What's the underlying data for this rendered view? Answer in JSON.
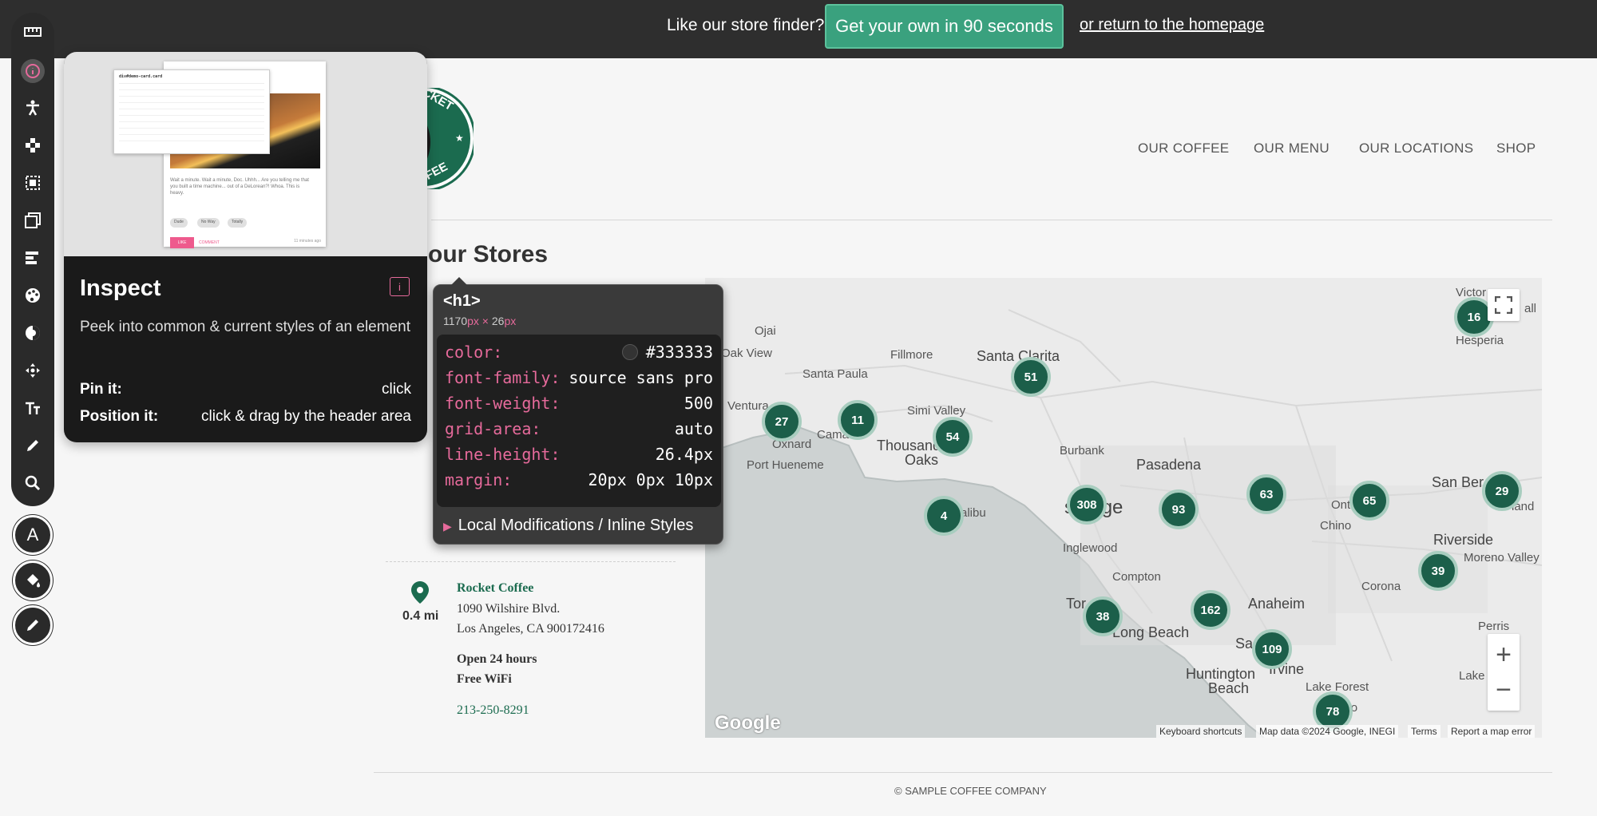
{
  "banner": {
    "prompt": "Like our store finder?",
    "cta": "Get your own in 90 seconds",
    "home_link": "or return to the homepage"
  },
  "logo": {
    "top_text": "CKET",
    "bottom_text": "FEE"
  },
  "nav": [
    "OUR COFFEE",
    "OUR MENU",
    "OUR LOCATIONS",
    "SHOP"
  ],
  "page_title": "our Stores",
  "map": {
    "places": [
      {
        "name": "Santa Clarita",
        "size": "big"
      },
      {
        "name": "Fillmore",
        "size": "normal"
      },
      {
        "name": "Santa Paula",
        "size": "normal"
      },
      {
        "name": "Ojai",
        "size": "normal"
      },
      {
        "name": "Oak View",
        "size": "normal"
      },
      {
        "name": "Ventura",
        "size": "normal"
      },
      {
        "name": "Oxnard",
        "size": "normal"
      },
      {
        "name": "Camar",
        "size": "normal"
      },
      {
        "name": "Simi Valley",
        "size": "normal"
      },
      {
        "name": "Thousand",
        "size": "big"
      },
      {
        "name": "Oaks",
        "size": "big"
      },
      {
        "name": "Port Hueneme",
        "size": "normal"
      },
      {
        "name": "Burbank",
        "size": "normal"
      },
      {
        "name": "Pasadena",
        "size": "big"
      },
      {
        "name": "s Ange",
        "size": "big"
      },
      {
        "name": "alibu",
        "size": "normal"
      },
      {
        "name": "Inglewood",
        "size": "normal"
      },
      {
        "name": "Compton",
        "size": "normal"
      },
      {
        "name": "Tor",
        "size": "big"
      },
      {
        "name": "Long Beach",
        "size": "big"
      },
      {
        "name": "Anaheim",
        "size": "big"
      },
      {
        "name": "Sa",
        "size": "big"
      },
      {
        "name": "Irvine",
        "size": "big"
      },
      {
        "name": "Huntington",
        "size": "big"
      },
      {
        "name": "Beach",
        "size": "big"
      },
      {
        "name": "Lake Forest",
        "size": "normal"
      },
      {
        "name": "Viejo",
        "size": "normal"
      },
      {
        "name": "Ont",
        "size": "normal"
      },
      {
        "name": "Chino",
        "size": "normal"
      },
      {
        "name": "Corona",
        "size": "normal"
      },
      {
        "name": "Riverside",
        "size": "big"
      },
      {
        "name": "Moreno Valley",
        "size": "normal"
      },
      {
        "name": "San Ber",
        "size": "big"
      },
      {
        "name": "Hesperia",
        "size": "normal"
      },
      {
        "name": "Victor",
        "size": "normal"
      },
      {
        "name": "Perris",
        "size": "normal"
      },
      {
        "name": "Lake Elsin",
        "size": "normal"
      },
      {
        "name": "land",
        "size": "normal"
      },
      {
        "name": "all",
        "size": "normal"
      }
    ],
    "clusters": [
      "51",
      "27",
      "11",
      "54",
      "4",
      "308",
      "93",
      "63",
      "65",
      "29",
      "16",
      "39",
      "162",
      "38",
      "109",
      "78"
    ],
    "fullscreen_icon": "fullscreen-icon",
    "zoom_in": "+",
    "zoom_out": "−",
    "logo_text": "Google",
    "attribution": [
      "Keyboard shortcuts",
      "Map data ©2024 Google, INEGI",
      "Terms",
      "Report a map error"
    ]
  },
  "store": {
    "name": "Rocket Coffee",
    "distance": "0.4 mi",
    "address1": "1090 Wilshire Blvd.",
    "address2": "Los Angeles, CA 900172416",
    "hours": "Open 24 hours",
    "amenity": "Free WiFi",
    "phone": "213-250-8291"
  },
  "footer": "© SAMPLE COFFEE COMPANY",
  "toolbar": {
    "tools": [
      "ruler-icon",
      "info-icon",
      "accessibility-icon",
      "move-icon",
      "margin-icon",
      "padding-icon",
      "align-icon",
      "palette-icon",
      "hue-icon",
      "position-icon",
      "text-icon",
      "pencil-icon",
      "search-icon"
    ],
    "text_button": "A"
  },
  "inspect_panel": {
    "title": "Inspect",
    "shortcut": "i",
    "description": "Peek into common & current styles of an element",
    "pin_label": "Pin it:",
    "pin_value": "click",
    "position_label": "Position it:",
    "position_value": "click & drag by the header area",
    "preview": {
      "selector": "div#demo-card.card",
      "body_text": "Wait a minute. Wait a minute, Doc. Uhhh... Are you telling me that you built a time machine... out of a DeLorean?! Whoa. This is heavy.",
      "chips": [
        "Dude",
        "No Way",
        "Totally"
      ],
      "like": "LIKE",
      "comment": "COMMENT",
      "time": "11 minutes ago"
    }
  },
  "element_popover": {
    "tag": "<h1>",
    "width": "1170",
    "height": "26",
    "unit": "px",
    "times": "×",
    "props": [
      {
        "name": "color:",
        "value": "#333333"
      },
      {
        "name": "font-family:",
        "value": "source sans pro"
      },
      {
        "name": "font-weight:",
        "value": "500"
      },
      {
        "name": "grid-area:",
        "value": "auto"
      },
      {
        "name": "line-height:",
        "value": "26.4px"
      },
      {
        "name": "margin:",
        "value": "20px 0px 10px"
      }
    ],
    "local_mods": "Local Modifications / Inline Styles"
  }
}
